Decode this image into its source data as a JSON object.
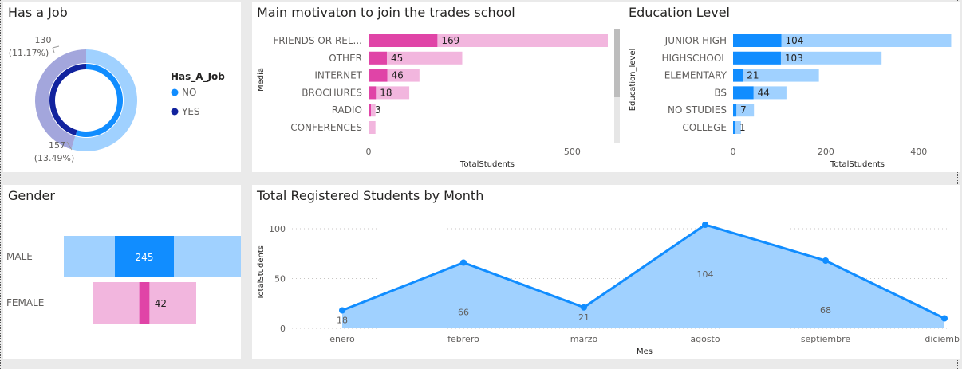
{
  "panels": {
    "job": {
      "title": "Has a Job"
    },
    "motivation": {
      "title": "Main motivaton to join the trades school"
    },
    "education": {
      "title": "Education Level"
    },
    "gender": {
      "title": "Gender"
    },
    "monthly": {
      "title": "Total Registered Students by Month"
    }
  },
  "colors": {
    "blue": "#118dff",
    "light_blue": "#a0d1ff",
    "pink": "#e044a7",
    "light_pink": "#f2b6de",
    "navy": "#12239e",
    "lavender": "#a3a6dc"
  },
  "chart_data": [
    {
      "id": "job",
      "type": "pie",
      "title": "Has a Job",
      "legend_title": "Has_A_Job",
      "legend_position": "right",
      "labels": [
        "NO",
        "YES"
      ],
      "outer_values": [
        157,
        130
      ],
      "outer_percent_labels": [
        "(13.49%)",
        "(11.17%)"
      ],
      "inner_values": [
        157,
        130
      ]
    },
    {
      "id": "motivation",
      "type": "bar",
      "orientation": "horizontal",
      "title": "Main motivaton to join the trades school",
      "ylabel": "Media",
      "xlabel": "TotalStudents",
      "xlim": [
        0,
        650
      ],
      "xticks": [
        "0",
        "500"
      ],
      "categories": [
        "FRIENDS OR REL...",
        "OTHER",
        "INTERNET",
        "BROCHURES",
        "RADIO",
        "CONFERENCES"
      ],
      "values": [
        169,
        45,
        46,
        18,
        3,
        null
      ],
      "background_values": [
        650,
        230,
        125,
        100,
        17,
        17
      ]
    },
    {
      "id": "education",
      "type": "bar",
      "orientation": "horizontal",
      "title": "Education Level",
      "ylabel": "Education_level",
      "xlabel": "TotalStudents",
      "xlim": [
        0,
        440
      ],
      "xticks": [
        "0",
        "200",
        "400"
      ],
      "categories": [
        "JUNIOR HIGH",
        "HIGHSCHOOL",
        "ELEMENTARY",
        "BS",
        "NO STUDIES",
        "COLLEGE"
      ],
      "values": [
        104,
        103,
        21,
        44,
        7,
        1
      ],
      "background_values": [
        470,
        320,
        185,
        115,
        45,
        17
      ]
    },
    {
      "id": "gender",
      "type": "bar",
      "orientation": "horizontal",
      "title": "Gender",
      "categories": [
        "MALE",
        "FEMALE"
      ],
      "values": [
        245,
        42
      ]
    },
    {
      "id": "monthly",
      "type": "area",
      "title": "Total Registered Students by Month",
      "xlabel": "Mes",
      "ylabel": "TotalStudents",
      "ylim": [
        0,
        112
      ],
      "yticks": [
        "0",
        "50",
        "100"
      ],
      "categories": [
        "enero",
        "febrero",
        "marzo",
        "agosto",
        "septiembre",
        "diciemb"
      ],
      "values": [
        18,
        66,
        21,
        104,
        68,
        10
      ],
      "data_labels": [
        "18",
        "66",
        "21",
        "104",
        "68",
        ""
      ],
      "grid": true
    }
  ]
}
